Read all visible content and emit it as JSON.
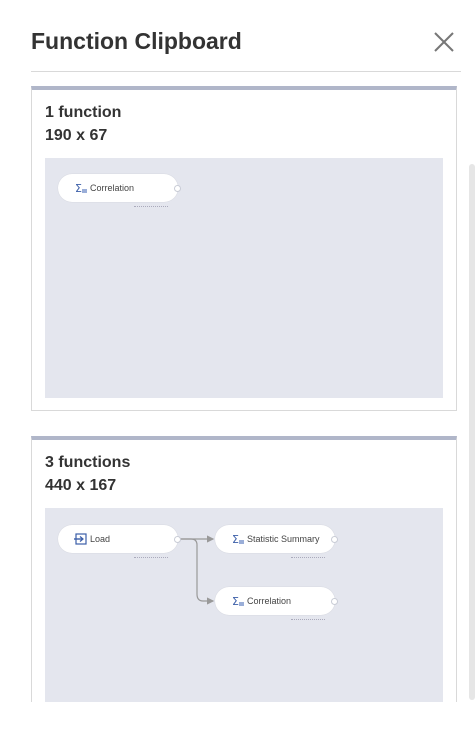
{
  "panel": {
    "title": "Function Clipboard",
    "close_icon": "close-icon"
  },
  "cards": [
    {
      "count_label": "1 function",
      "size_label": "190 x 67",
      "nodes": [
        {
          "label": "Correlation",
          "icon": "sigma-icon"
        }
      ]
    },
    {
      "count_label": "3 functions",
      "size_label": "440 x 167",
      "nodes": [
        {
          "label": "Load",
          "icon": "import-icon"
        },
        {
          "label": "Statistic Summary",
          "icon": "sigma-icon"
        },
        {
          "label": "Correlation",
          "icon": "sigma-icon"
        }
      ]
    }
  ],
  "colors": {
    "card_top_border": "#b0b6c9",
    "canvas_bg": "#e4e6ee",
    "icon_blue": "#3b5ea8"
  }
}
